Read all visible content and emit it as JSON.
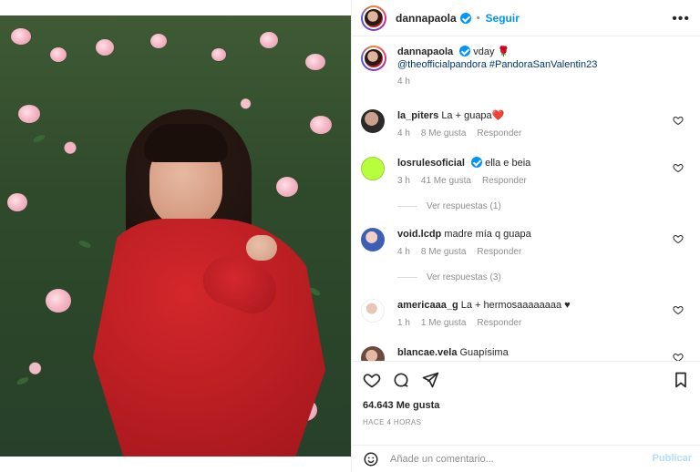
{
  "post": {
    "author": "dannapaola",
    "follow_label": "Seguir",
    "more_label": "•••",
    "caption": {
      "username": "dannapaola",
      "text": "vday 🌹",
      "mentions": "@theofficialpandora #PandoraSanValentin23",
      "time": "4 h"
    },
    "comments": [
      {
        "username": "la_piters",
        "text": "La + guapa❤️",
        "time": "4 h",
        "likes": "8 Me gusta",
        "reply_label": "Responder"
      },
      {
        "username": "losrulesoficial",
        "text": "ella e beia",
        "time": "3 h",
        "likes": "41 Me gusta",
        "reply_label": "Responder",
        "view_replies": "Ver respuestas (1)"
      },
      {
        "username": "void.lcdp",
        "text": "madre mía q guapa",
        "time": "4 h",
        "likes": "8 Me gusta",
        "reply_label": "Responder",
        "view_replies": "Ver respuestas (3)"
      },
      {
        "username": "americaaa_g",
        "text": "La + hermosaaaaaaaa ♥",
        "time": "1 h",
        "likes": "1 Me gusta",
        "reply_label": "Responder"
      },
      {
        "username": "blancae.vela",
        "text": "Guapísima"
      }
    ],
    "likes_count": "64.643 Me gusta",
    "timestamp": "HACE 4 HORAS",
    "composer": {
      "placeholder": "Añade un comentario...",
      "publish_label": "Publicar"
    }
  },
  "colors": {
    "accent": "#0095f6",
    "heart": "#e11d48",
    "muted": "#8e8e8e"
  }
}
